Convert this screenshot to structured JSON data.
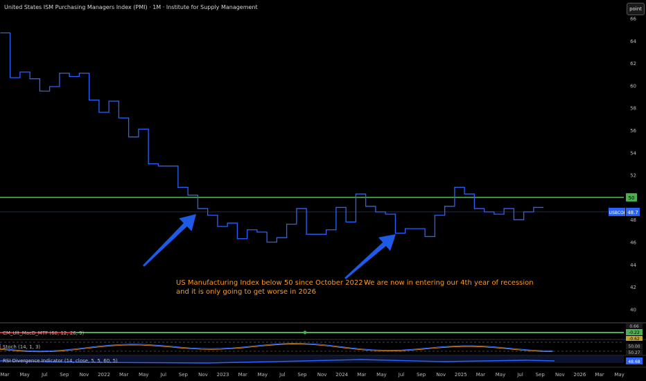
{
  "title": "United States ISM Purchasing Managers Index (PMI) · 1M · Institute for Supply Management",
  "toolbar": {
    "point_label": "point"
  },
  "annotations": {
    "left_line1": "US Manufacturing Index below 50 since October 2022 -",
    "left_line2": "and it is only going to get worse in 2026",
    "right_line1": "We are now in entering our 4th year of recession"
  },
  "chart_data": {
    "type": "line",
    "step": true,
    "ylim": [
      39,
      66
    ],
    "y_ticks": [
      40,
      42,
      44,
      46,
      48,
      50,
      52,
      54,
      56,
      58,
      60,
      62,
      64,
      66
    ],
    "x_tick_labels": [
      "Mar",
      "May",
      "Jul",
      "Sep",
      "Nov",
      "2022",
      "Mar",
      "May",
      "Jul",
      "Sep",
      "Nov",
      "2023",
      "Mar",
      "May",
      "Jul",
      "Sep",
      "Nov",
      "2024",
      "Mar",
      "May",
      "Jul",
      "Sep",
      "Nov",
      "2025",
      "Mar",
      "May",
      "Jul",
      "Sep",
      "Nov",
      "2026",
      "Mar",
      "May"
    ],
    "months": [
      "2021-03",
      "2021-04",
      "2021-05",
      "2021-06",
      "2021-07",
      "2021-08",
      "2021-09",
      "2021-10",
      "2021-11",
      "2021-12",
      "2022-01",
      "2022-02",
      "2022-03",
      "2022-04",
      "2022-05",
      "2022-06",
      "2022-07",
      "2022-08",
      "2022-09",
      "2022-10",
      "2022-11",
      "2022-12",
      "2023-01",
      "2023-02",
      "2023-03",
      "2023-04",
      "2023-05",
      "2023-06",
      "2023-07",
      "2023-08",
      "2023-09",
      "2023-10",
      "2023-11",
      "2023-12",
      "2024-01",
      "2024-02",
      "2024-03",
      "2024-04",
      "2024-05",
      "2024-06",
      "2024-07",
      "2024-08",
      "2024-09",
      "2024-10",
      "2024-11",
      "2024-12",
      "2025-01",
      "2025-02",
      "2025-03",
      "2025-04",
      "2025-05",
      "2025-06",
      "2025-07",
      "2025-08",
      "2025-09"
    ],
    "values": [
      64.7,
      60.7,
      61.2,
      60.6,
      59.5,
      59.9,
      61.1,
      60.8,
      61.1,
      58.7,
      57.6,
      58.6,
      57.1,
      55.4,
      56.1,
      53.0,
      52.8,
      52.8,
      50.9,
      50.2,
      49.0,
      48.4,
      47.4,
      47.7,
      46.3,
      47.1,
      46.9,
      46.0,
      46.4,
      47.6,
      49.0,
      46.7,
      46.7,
      47.1,
      49.1,
      47.8,
      50.3,
      49.2,
      48.7,
      48.5,
      46.8,
      47.2,
      47.2,
      46.5,
      48.4,
      49.2,
      50.9,
      50.3,
      49.0,
      48.7,
      48.5,
      49.0,
      48.0,
      48.7,
      49.1
    ],
    "last_value_label": "48.7",
    "symbol_tag": "USBCOI",
    "reference_line": {
      "value": 50,
      "label": "50",
      "color": "#4caf50"
    },
    "line_color": "#2962ff",
    "arrows_color": "#1e5ae6",
    "indicators": [
      {
        "name": "CM_Ult_MacD_MTF (60, 12, 26, 9)",
        "value_labels": [
          "0.66",
          "-0.22",
          "-0.62"
        ]
      },
      {
        "name": "Stoch (14, 1, 3)",
        "value_labels": [
          "50.00",
          "50.27"
        ]
      },
      {
        "name": "RSI Divergence Indicator (14, close, 5, 5, 60, 5)",
        "value_labels": [
          "48.68"
        ]
      }
    ]
  }
}
